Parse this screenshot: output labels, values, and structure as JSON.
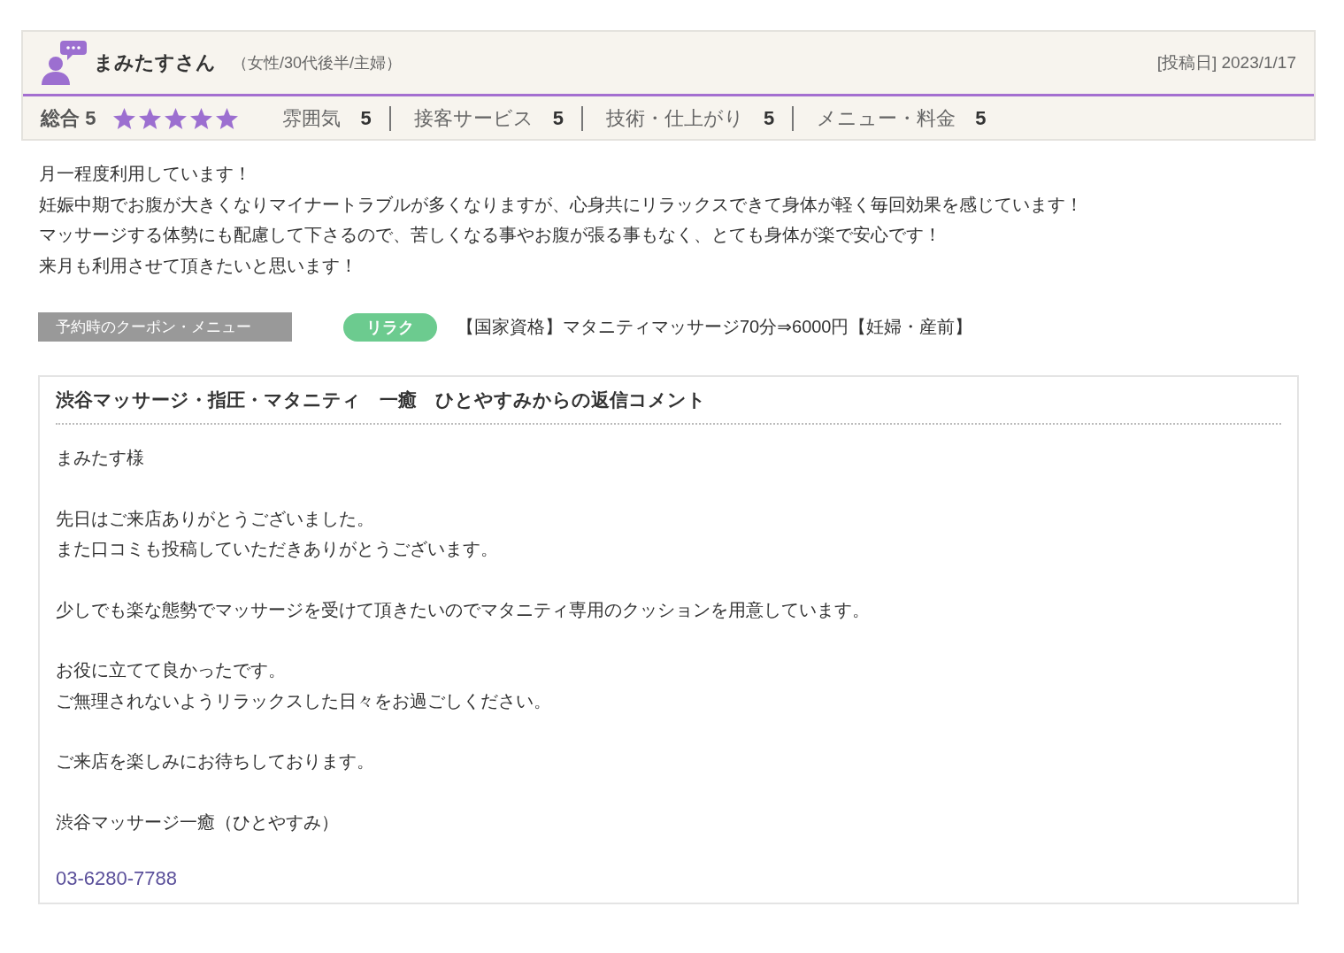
{
  "review": {
    "reviewer_name": "まみたすさん",
    "reviewer_profile": "（女性/30代後半/主婦）",
    "posted_date": "[投稿日] 2023/1/17",
    "overall": {
      "label": "総合",
      "score": "5",
      "stars": 5
    },
    "ratings": [
      {
        "label": "雰囲気",
        "score": "5"
      },
      {
        "label": "接客サービス",
        "score": "5"
      },
      {
        "label": "技術・仕上がり",
        "score": "5"
      },
      {
        "label": "メニュー・料金",
        "score": "5"
      }
    ],
    "body": [
      "月一程度利用しています！",
      "妊娠中期でお腹が大きくなりマイナートラブルが多くなりますが、心身共にリラックスできて身体が軽く毎回効果を感じています！",
      "マッサージする体勢にも配慮して下さるので、苦しくなる事やお腹が張る事もなく、とても身体が楽で安心です！",
      "来月も利用させて頂きたいと思います！"
    ],
    "coupon": {
      "label": "予約時のクーポン・メニュー",
      "tag": "リラク",
      "color": "#6ccb8f",
      "name": "【国家資格】マタニティマッサージ70分⇒6000円【妊婦・産前】"
    }
  },
  "reply": {
    "title": "渋谷マッサージ・指圧・マタニティ　一癒　ひとやすみからの返信コメント",
    "paragraphs": [
      [
        "まみたす様"
      ],
      [
        "先日はご来店ありがとうございました。",
        "また口コミも投稿していただきありがとうございます。"
      ],
      [
        "少しでも楽な態勢でマッサージを受けて頂きたいのでマタニティ専用のクッションを用意しています。"
      ],
      [
        "お役に立てて良かったです。",
        "ご無理されないようリラックスした日々をお過ごしください。"
      ],
      [
        "ご来店を楽しみにお待ちしております。"
      ],
      [
        "渋谷マッサージ一癒（ひとやすみ）"
      ]
    ],
    "phone": "03-6280-7788"
  }
}
